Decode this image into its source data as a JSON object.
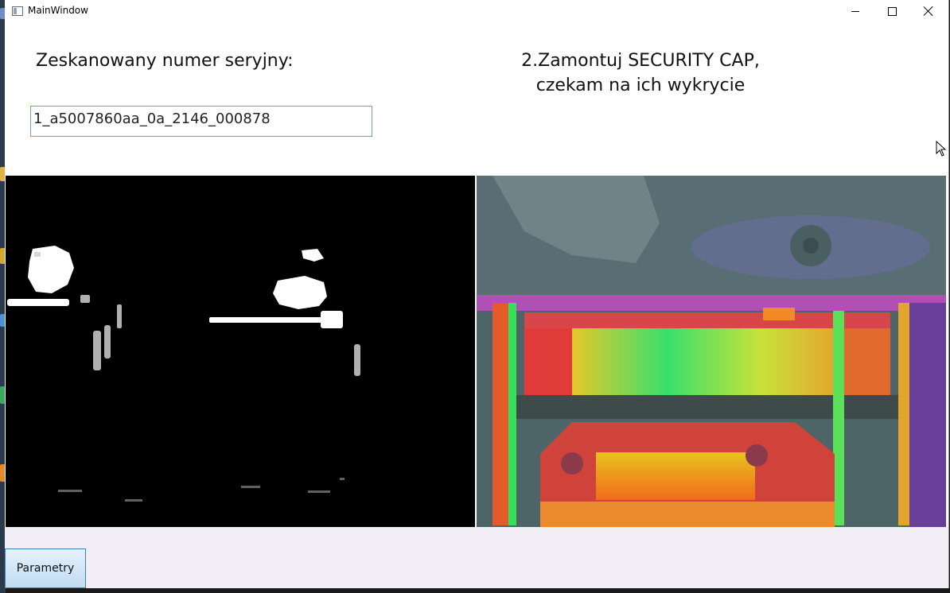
{
  "window": {
    "title": "MainWindow"
  },
  "serial": {
    "label": "Zeskanowany numer seryjny:",
    "value": "1_a5007860aa_0a_2146_000878"
  },
  "instruction": {
    "line1": "2.Zamontuj SECURITY CAP,",
    "line2": "czekam na ich wykrycie"
  },
  "buttons": {
    "parametry": "Parametry"
  },
  "icons": {
    "app": "window-app-icon",
    "minimize": "minimize-icon",
    "maximize": "maximize-icon",
    "close": "close-icon",
    "cursor": "mouse-pointer-icon"
  },
  "colors": {
    "input_border": "#7a9cc4",
    "button_border": "#3c7fb1",
    "bottom_bar": "#f1eef6"
  }
}
